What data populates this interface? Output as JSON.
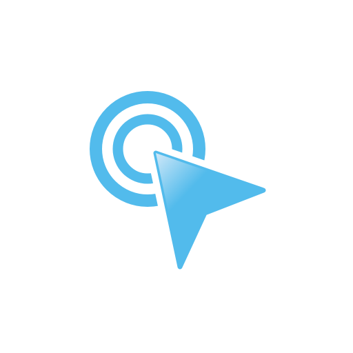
{
  "icon": {
    "name": "click-cursor-icon",
    "parts": [
      "outer-ring",
      "inner-ring",
      "cursor-arrow"
    ]
  },
  "colors": {
    "background": "#ffffff",
    "accent": "#52bbec",
    "highlight": "#cfe8f8"
  }
}
